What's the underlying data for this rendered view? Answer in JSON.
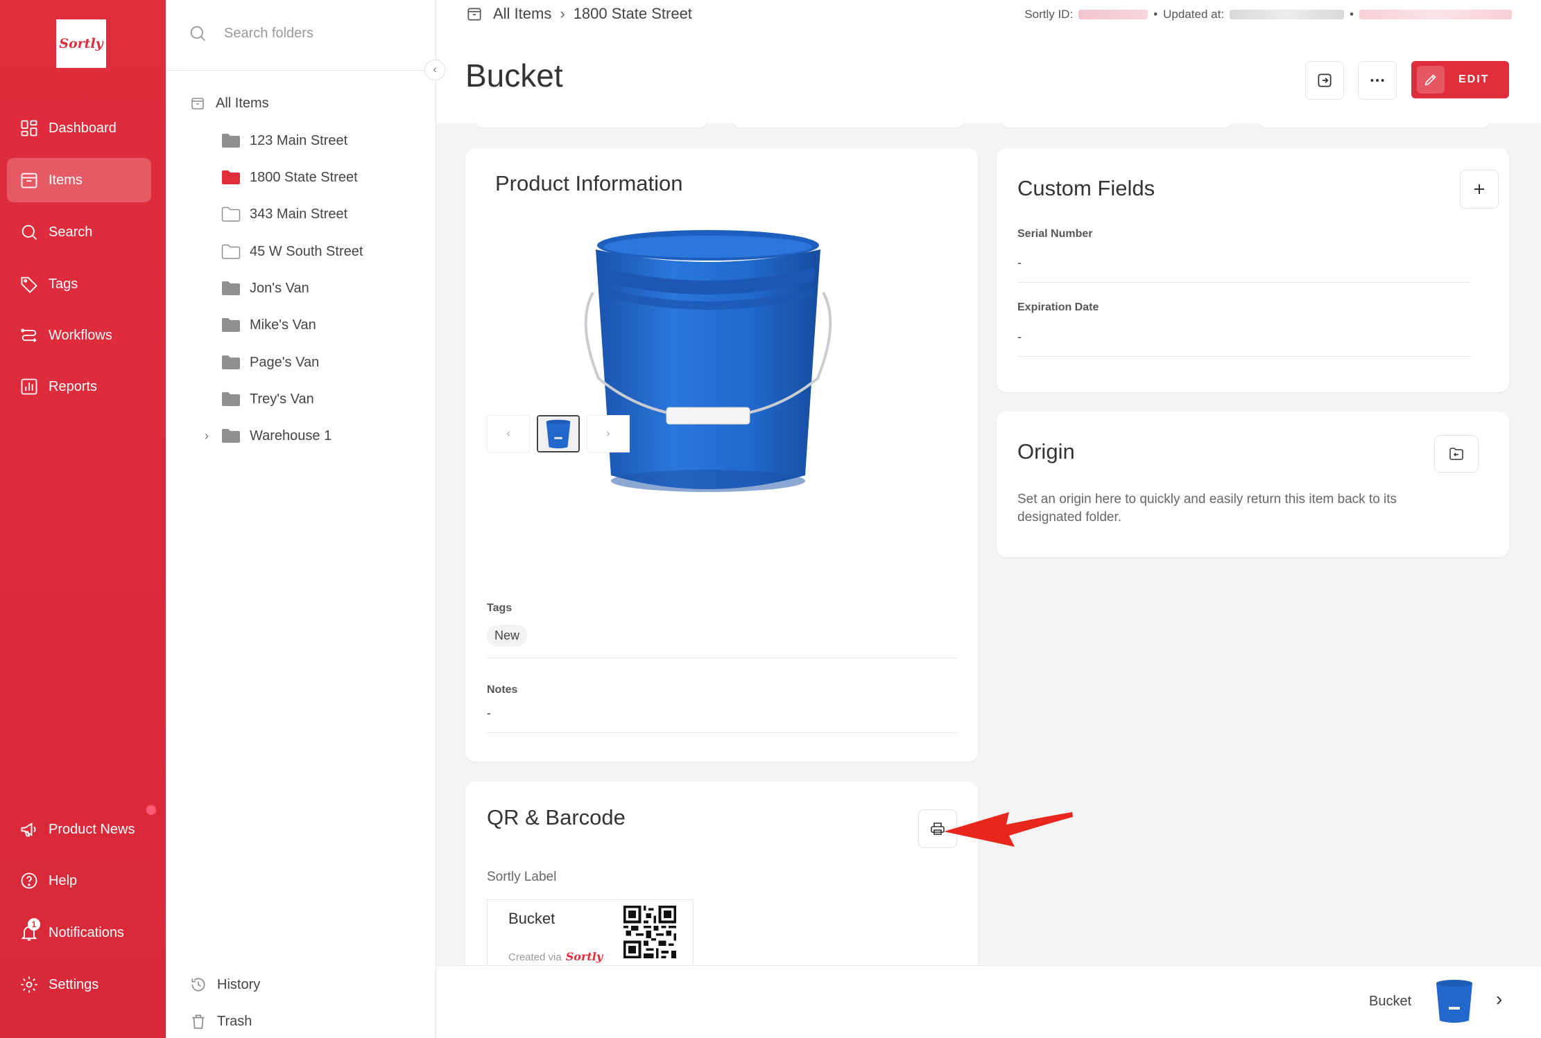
{
  "app": {
    "logo_text": "Sortly"
  },
  "nav": {
    "items": [
      {
        "label": "Dashboard",
        "icon": "dashboard-icon"
      },
      {
        "label": "Items",
        "icon": "items-icon"
      },
      {
        "label": "Search",
        "icon": "search-icon"
      },
      {
        "label": "Tags",
        "icon": "tag-icon"
      },
      {
        "label": "Workflows",
        "icon": "workflows-icon"
      },
      {
        "label": "Reports",
        "icon": "reports-icon"
      }
    ],
    "bottom_items": [
      {
        "label": "Product News",
        "icon": "megaphone-icon"
      },
      {
        "label": "Help",
        "icon": "help-icon"
      },
      {
        "label": "Notifications",
        "icon": "bell-icon"
      },
      {
        "label": "Settings",
        "icon": "gear-icon"
      }
    ],
    "notifications_count": "1",
    "active": "Items"
  },
  "folders": {
    "search_placeholder": "Search folders",
    "root": "All Items",
    "list": [
      {
        "name": "123 Main Street",
        "style": "filled"
      },
      {
        "name": "1800 State Street",
        "style": "selected"
      },
      {
        "name": "343 Main Street",
        "style": "outline"
      },
      {
        "name": "45 W South Street",
        "style": "outline"
      },
      {
        "name": "Jon's Van",
        "style": "filled"
      },
      {
        "name": "Mike's Van",
        "style": "filled"
      },
      {
        "name": "Page's Van",
        "style": "filled"
      },
      {
        "name": "Trey's Van",
        "style": "filled"
      },
      {
        "name": "Warehouse 1",
        "style": "filled",
        "expandable": true
      }
    ],
    "history": "History",
    "trash": "Trash"
  },
  "header": {
    "breadcrumb_root": "All Items",
    "breadcrumb_current": "1800 State Street",
    "sortly_id_label": "Sortly ID:",
    "updated_label": "Updated at:",
    "title": "Bucket",
    "edit_label": "EDIT"
  },
  "product_info": {
    "title": "Product Information",
    "tags_label": "Tags",
    "tags": [
      "New"
    ],
    "notes_label": "Notes",
    "notes_value": "-"
  },
  "custom_fields": {
    "title": "Custom Fields",
    "fields": [
      {
        "label": "Serial Number",
        "value": "-"
      },
      {
        "label": "Expiration Date",
        "value": "-"
      }
    ]
  },
  "origin": {
    "title": "Origin",
    "description": "Set an origin here to quickly and easily return this item back to its designated folder."
  },
  "qr": {
    "title": "QR & Barcode",
    "label_title": "Sortly Label",
    "label_item": "Bucket",
    "label_created": "Created via",
    "label_brand": "Sortly"
  },
  "bottom_bar": {
    "item_name": "Bucket"
  },
  "colors": {
    "brand": "#e02d3c",
    "bucket": "#1f66c9",
    "annotation_arrow": "#e8261c"
  }
}
